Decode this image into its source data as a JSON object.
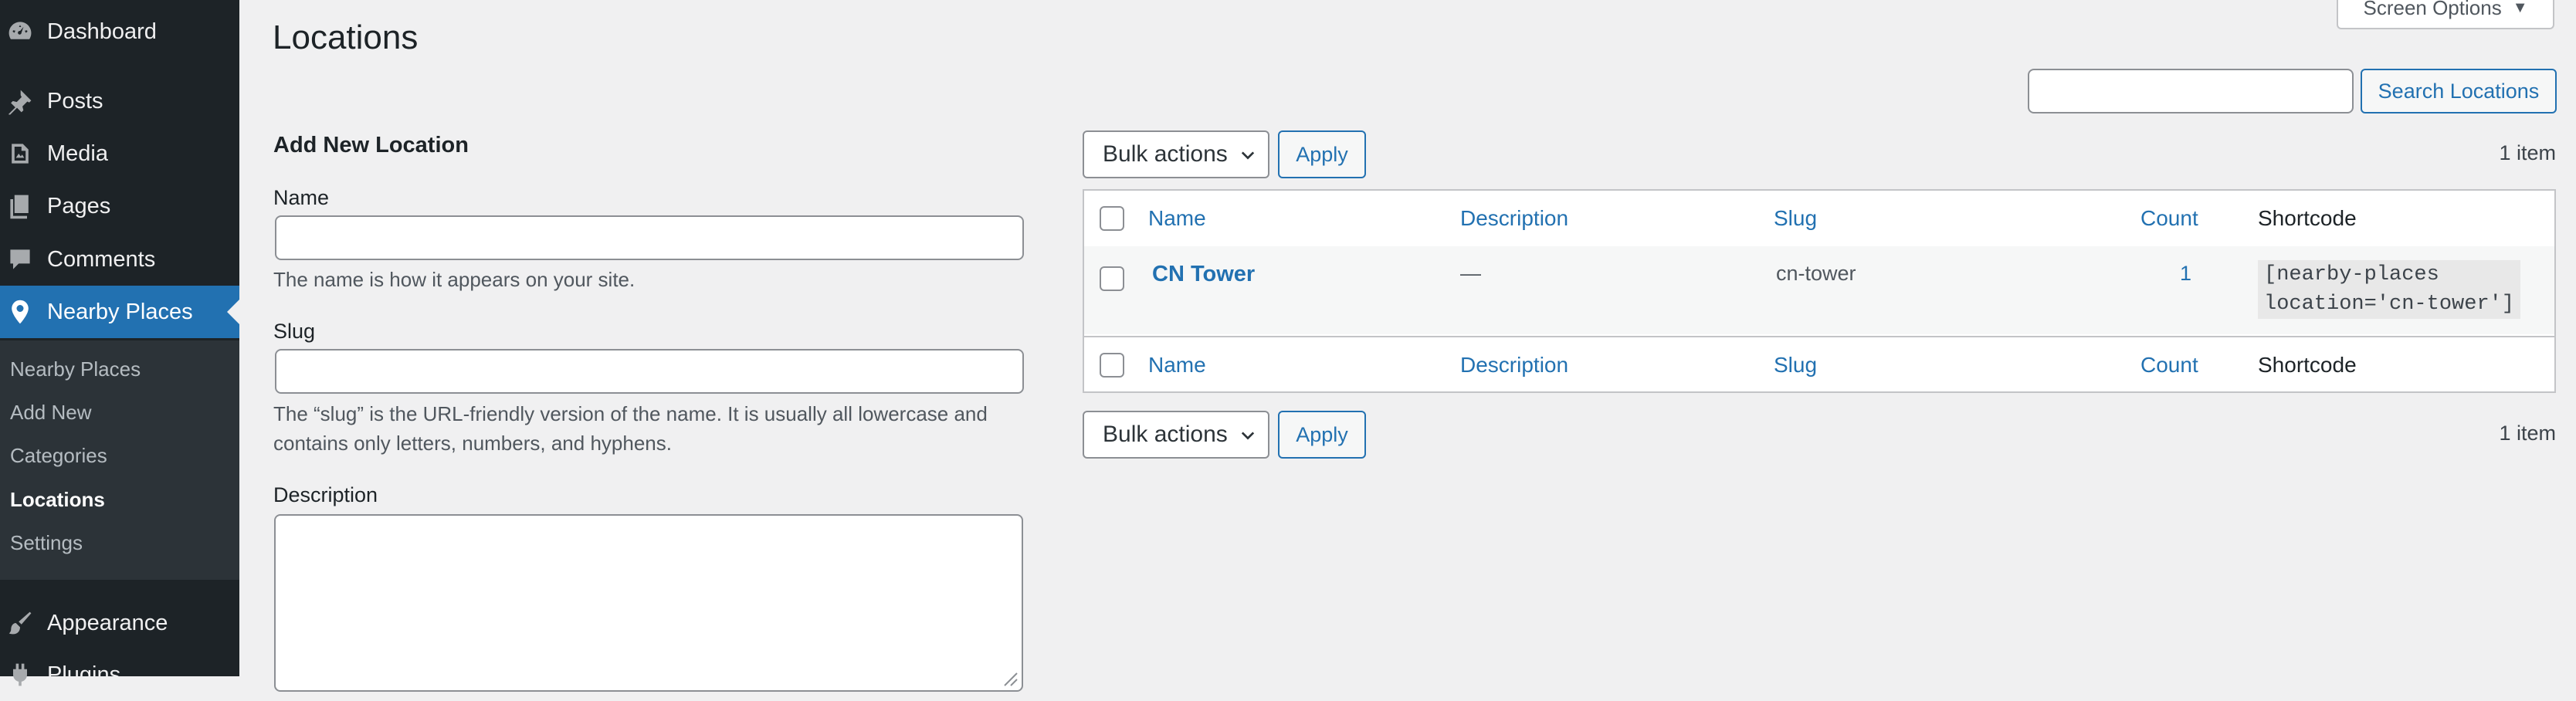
{
  "sidebar": {
    "top_items": [
      {
        "label": "Dashboard",
        "icon": "dashboard-icon"
      },
      {
        "label": "Posts",
        "icon": "pin-icon"
      },
      {
        "label": "Media",
        "icon": "media-icon"
      },
      {
        "label": "Pages",
        "icon": "pages-icon"
      },
      {
        "label": "Comments",
        "icon": "comment-icon"
      },
      {
        "label": "Nearby Places",
        "icon": "location-pin-icon",
        "current": true
      },
      {
        "label": "Appearance",
        "icon": "paintbrush-icon"
      },
      {
        "label": "Plugins",
        "icon": "plugin-icon"
      }
    ],
    "submenu": [
      "Nearby Places",
      "Add New",
      "Categories",
      "Locations",
      "Settings"
    ],
    "submenu_current": "Locations"
  },
  "page": {
    "title": "Locations",
    "screen_options": "Screen Options",
    "search_button": "Search Locations",
    "search_value": ""
  },
  "form": {
    "heading": "Add New Location",
    "name_label": "Name",
    "name_value": "",
    "name_help": "The name is how it appears on your site.",
    "slug_label": "Slug",
    "slug_value": "",
    "slug_help": "The “slug” is the URL-friendly version of the name. It is usually all lowercase and contains only letters, numbers, and hyphens.",
    "description_label": "Description",
    "description_value": ""
  },
  "list": {
    "bulk_actions": "Bulk actions",
    "apply": "Apply",
    "items_count": "1 item",
    "columns": {
      "name": "Name",
      "description": "Description",
      "slug": "Slug",
      "count": "Count",
      "shortcode": "Shortcode"
    },
    "rows": [
      {
        "name": "CN Tower",
        "description": "—",
        "slug": "cn-tower",
        "count": "1",
        "shortcode": "[nearby-places\nlocation='cn-tower']"
      }
    ]
  },
  "colors": {
    "accent": "#2271b1",
    "sidebar_bg": "#1d2327",
    "submenu_bg": "#2c3338",
    "page_bg": "#f0f0f1"
  }
}
